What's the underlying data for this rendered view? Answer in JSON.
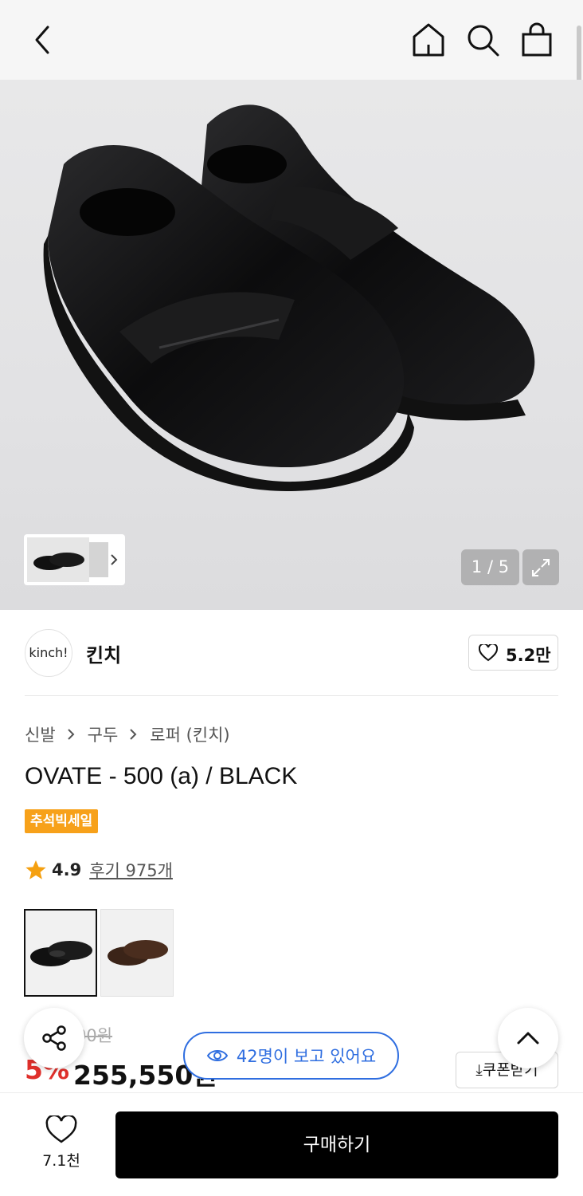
{
  "nav": {
    "back_icon": "chevron-left-icon",
    "home_icon": "home-icon",
    "search_icon": "search-icon",
    "bag_icon": "shopping-bag-icon"
  },
  "gallery": {
    "counter": "1 / 5",
    "expand_icon": "expand-icon"
  },
  "brand": {
    "logo_text": "kinch!",
    "name": "킨치",
    "likes": "5.2만"
  },
  "breadcrumb": [
    "신발",
    "구두",
    "로퍼 (킨치)"
  ],
  "product": {
    "title": "OVATE - 500 (a) / BLACK",
    "badge": "추석빅세일",
    "rating": "4.9",
    "reviews": "후기 975개"
  },
  "price": {
    "original": "00원",
    "discount": "5%",
    "sale": "255,550원",
    "coupon_label": "⤓쿠폰받기"
  },
  "floating": {
    "viewers": "42명이 보고 있어요"
  },
  "bottom": {
    "wish_count": "7.1천",
    "buy_label": "구매하기"
  },
  "colors": {
    "accent_blue": "#2f6ee0",
    "discount_red": "#e0302b",
    "badge_orange": "#f7a11a"
  }
}
